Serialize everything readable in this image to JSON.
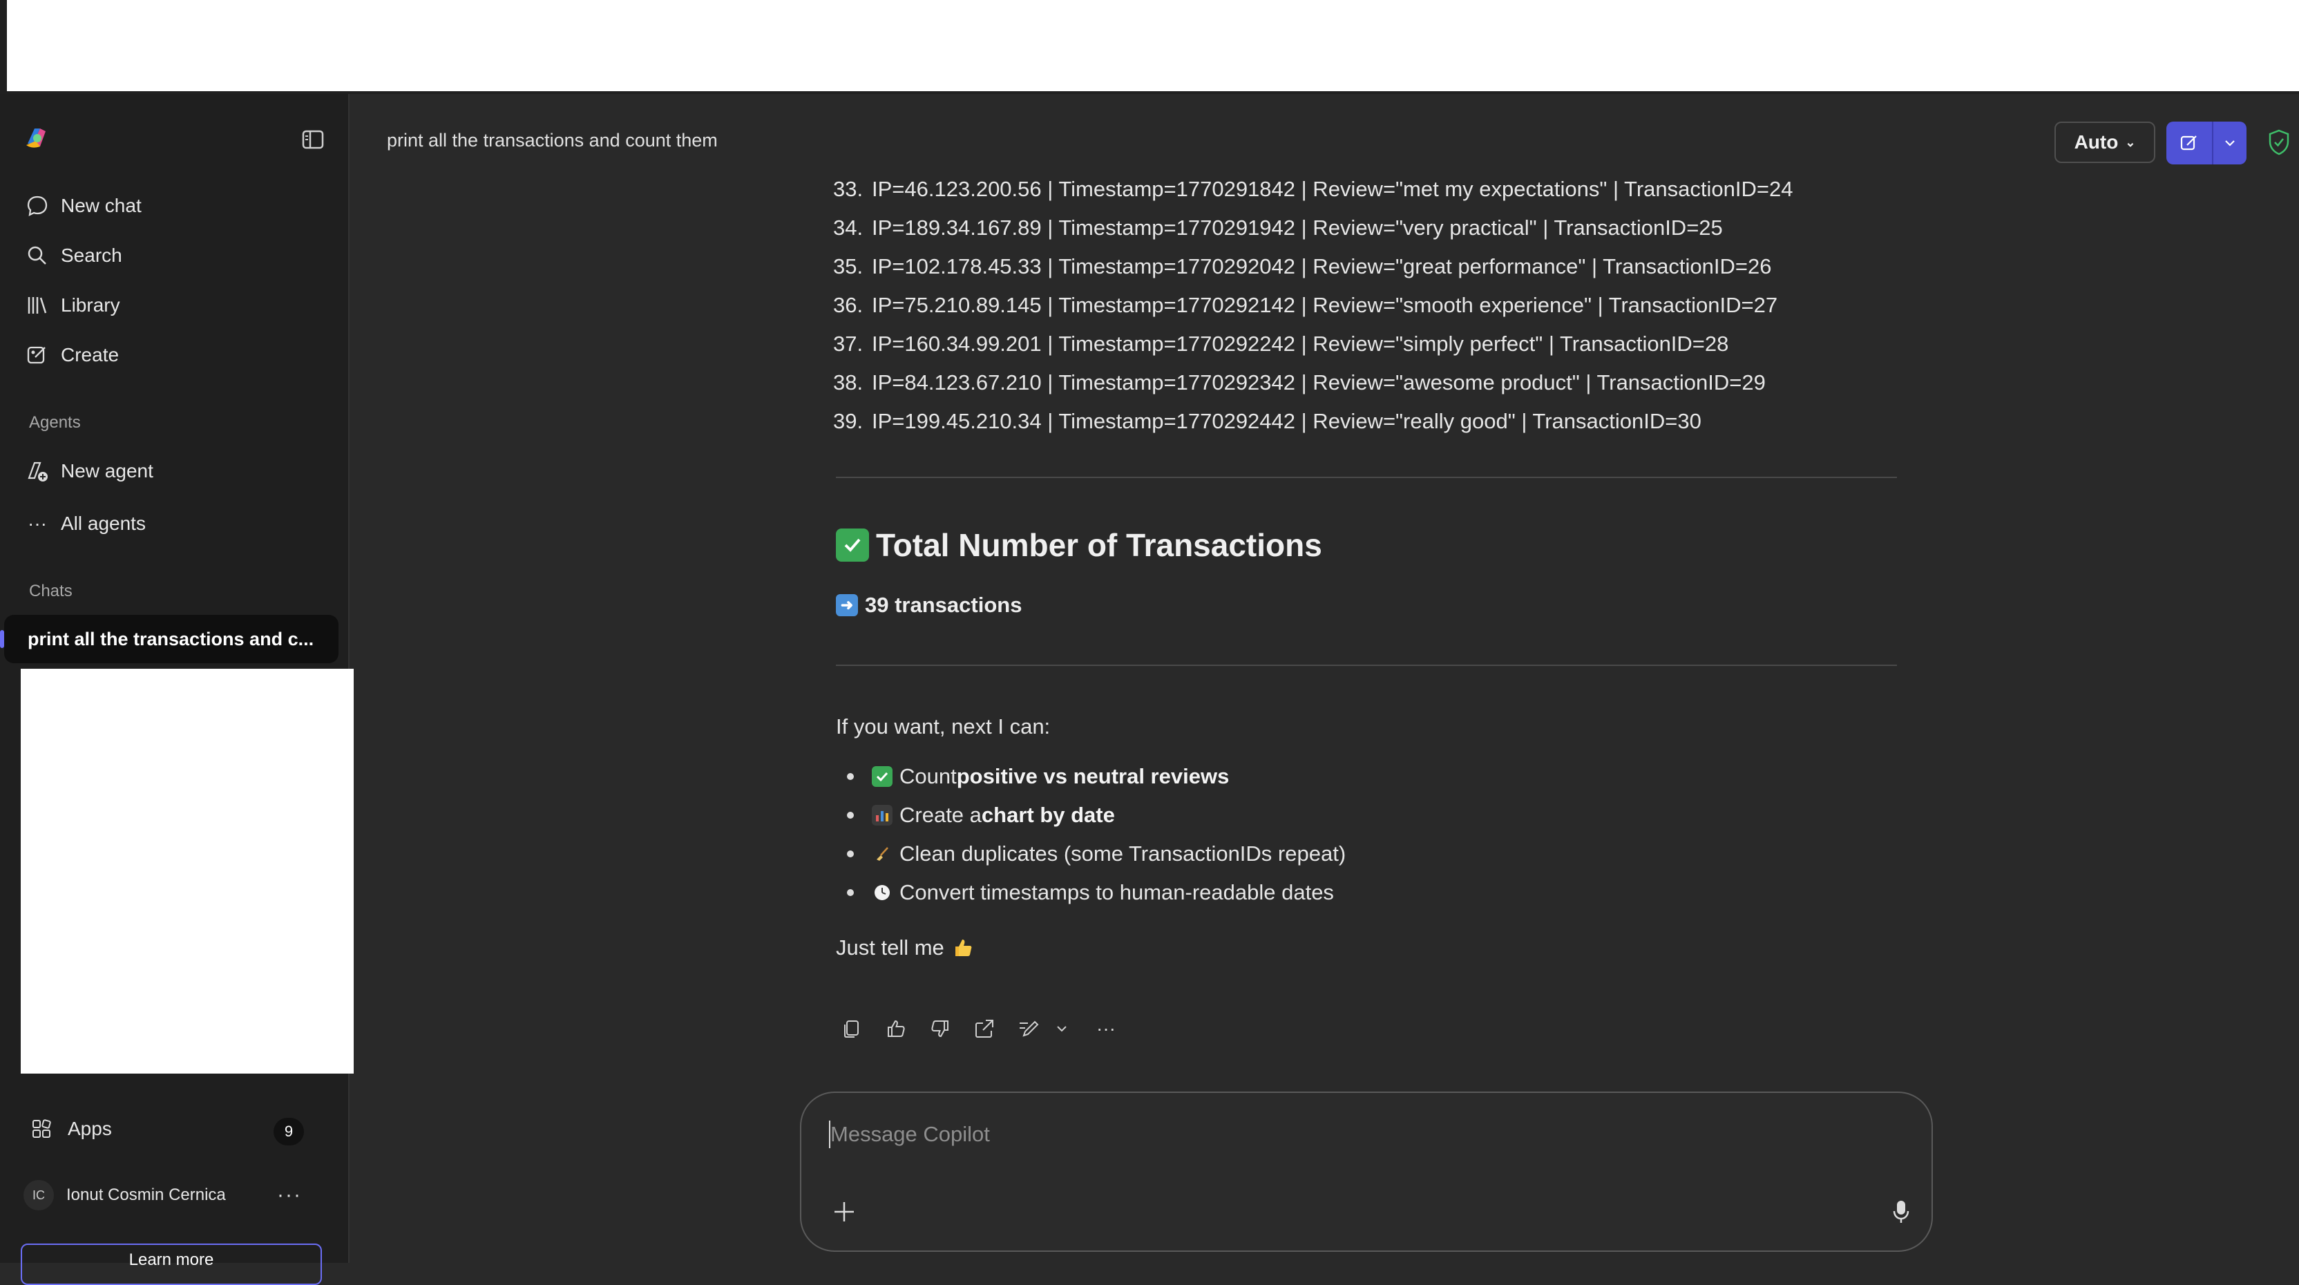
{
  "header": {
    "chat_title": "print all the transactions and count them",
    "model_label": "Auto"
  },
  "sidebar": {
    "nav": [
      {
        "label": "New chat",
        "icon": "chat-bubble-icon"
      },
      {
        "label": "Search",
        "icon": "search-icon"
      },
      {
        "label": "Library",
        "icon": "library-icon"
      },
      {
        "label": "Create",
        "icon": "create-icon"
      }
    ],
    "agents_label": "Agents",
    "agents": [
      {
        "label": "New agent",
        "icon": "new-agent-icon"
      },
      {
        "label": "All agents",
        "icon": "more-dots-icon"
      }
    ],
    "chats_label": "Chats",
    "selected_chat": "print all the transactions and c...",
    "apps_label": "Apps",
    "apps_badge": "9",
    "user_initials": "IC",
    "user_name": "Ionut Cosmin Cernica",
    "learn_more": "Learn more"
  },
  "transactions": [
    {
      "n": "33.",
      "text": "IP=46.123.200.56 | Timestamp=1770291842 | Review=\"met my expectations\" | TransactionID=24"
    },
    {
      "n": "34.",
      "text": "IP=189.34.167.89 | Timestamp=1770291942 | Review=\"very practical\" | TransactionID=25"
    },
    {
      "n": "35.",
      "text": "IP=102.178.45.33 | Timestamp=1770292042 | Review=\"great performance\" | TransactionID=26"
    },
    {
      "n": "36.",
      "text": "IP=75.210.89.145 | Timestamp=1770292142 | Review=\"smooth experience\" | TransactionID=27"
    },
    {
      "n": "37.",
      "text": "IP=160.34.99.201 | Timestamp=1770292242 | Review=\"simply perfect\" | TransactionID=28"
    },
    {
      "n": "38.",
      "text": "IP=84.123.67.210 | Timestamp=1770292342 | Review=\"awesome product\" | TransactionID=29"
    },
    {
      "n": "39.",
      "text": "IP=199.45.210.34 | Timestamp=1770292442 | Review=\"really good\" | TransactionID=30"
    }
  ],
  "summary": {
    "heading": "Total Number of Transactions",
    "count_text": "39 transactions",
    "intro": "If you want, next I can:",
    "options": [
      {
        "pre": "Count ",
        "bold": "positive vs neutral reviews",
        "post": ""
      },
      {
        "pre": "Create a ",
        "bold": "chart by date",
        "post": ""
      },
      {
        "pre": "Clean duplicates (some TransactionIDs repeat)",
        "bold": "",
        "post": ""
      },
      {
        "pre": "Convert timestamps to human-readable dates",
        "bold": "",
        "post": ""
      }
    ],
    "closing": "Just tell me"
  },
  "composer": {
    "placeholder": "Message Copilot"
  },
  "colors": {
    "accent": "#4f52d6",
    "background": "#292929",
    "sidebar": "#1f1f1f"
  }
}
